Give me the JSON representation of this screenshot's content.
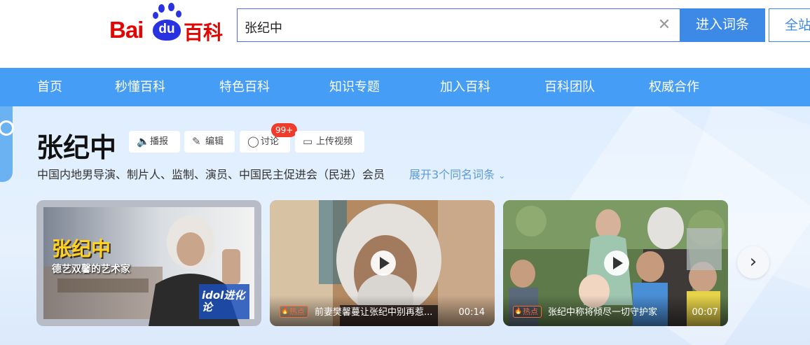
{
  "header": {
    "logo_bai": "Bai",
    "logo_du": "du",
    "logo_baike": "百科",
    "search_value": "张纪中",
    "enter_label": "进入词条",
    "site_label": "全站"
  },
  "nav": {
    "items": [
      "首页",
      "秒懂百科",
      "特色百科",
      "知识专题",
      "加入百科",
      "百科团队",
      "权威合作"
    ]
  },
  "entry": {
    "title": "张纪中",
    "actions": {
      "play": "播报",
      "edit": "编辑",
      "discuss": "讨论",
      "upload": "上传视频"
    },
    "discuss_badge": "99+",
    "summary": "中国内地男导演、制片人、监制、演员、中国民主促进会（民进）会员",
    "expand": "展开3个同名词条"
  },
  "videos": [
    {
      "overlay_title": "张纪中",
      "overlay_subtitle": "德艺双馨的艺术家",
      "watermark": "idol进化论"
    },
    {
      "tag": "热点",
      "caption": "前妻樊馨蔓让张纪中别再惹...",
      "duration": "00:14"
    },
    {
      "tag": "热点",
      "caption": "张纪中称将倾尽一切守护家",
      "duration": "00:07"
    }
  ],
  "colors": {
    "nav_bg": "#459df5",
    "primary": "#3d8ae6",
    "logo_red": "#e10602",
    "logo_blue": "#2932e1",
    "badge_red": "#f03c2a",
    "link": "#5c9ad8"
  }
}
